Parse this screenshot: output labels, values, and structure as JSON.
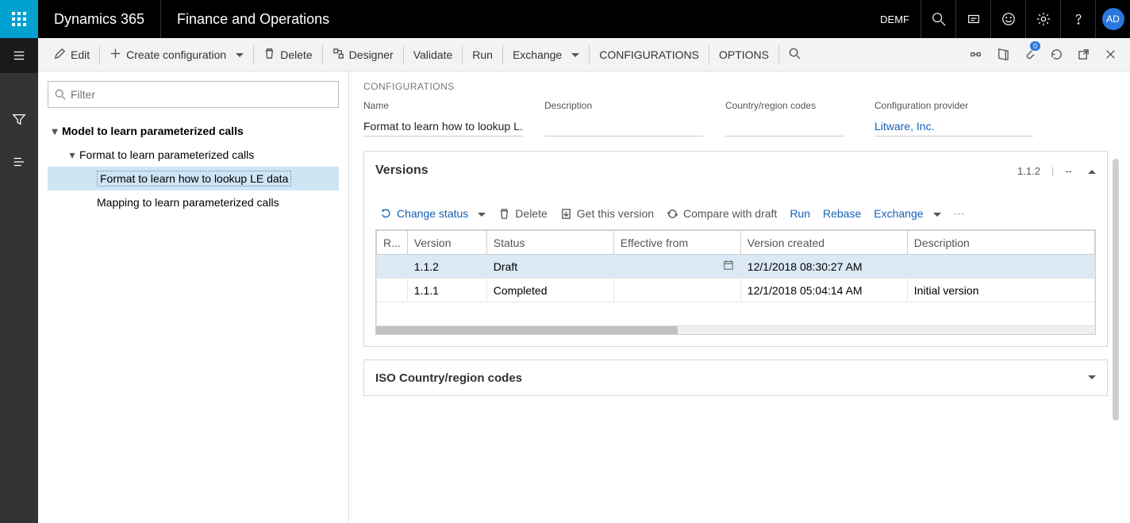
{
  "topbar": {
    "product": "Dynamics 365",
    "module": "Finance and Operations",
    "company": "DEMF",
    "avatar": "AD"
  },
  "actionbar": {
    "edit": "Edit",
    "create": "Create configuration",
    "delete": "Delete",
    "designer": "Designer",
    "validate": "Validate",
    "run": "Run",
    "exchange": "Exchange",
    "configurations": "CONFIGURATIONS",
    "options": "OPTIONS",
    "badge": "0"
  },
  "filter": {
    "placeholder": "Filter"
  },
  "tree": {
    "root": "Model to learn parameterized calls",
    "child1": "Format to learn parameterized calls",
    "grand1": "Format to learn how to lookup LE data",
    "grand2": "Mapping to learn parameterized calls"
  },
  "details": {
    "breadcrumb": "CONFIGURATIONS",
    "name_label": "Name",
    "name_value": "Format to learn how to lookup L...",
    "desc_label": "Description",
    "desc_value": "",
    "country_label": "Country/region codes",
    "country_value": "",
    "provider_label": "Configuration provider",
    "provider_value": "Litware, Inc."
  },
  "versions": {
    "title": "Versions",
    "summary": "1.1.2",
    "dash": "--",
    "toolbar": {
      "change_status": "Change status",
      "delete": "Delete",
      "get": "Get this version",
      "compare": "Compare with draft",
      "run": "Run",
      "rebase": "Rebase",
      "exchange": "Exchange"
    },
    "columns": {
      "r": "R...",
      "version": "Version",
      "status": "Status",
      "effective": "Effective from",
      "created": "Version created",
      "description": "Description"
    },
    "rows": [
      {
        "version": "1.1.2",
        "status": "Draft",
        "effective": "",
        "created": "12/1/2018 08:30:27 AM",
        "description": ""
      },
      {
        "version": "1.1.1",
        "status": "Completed",
        "effective": "",
        "created": "12/1/2018 05:04:14 AM",
        "description": "Initial version"
      }
    ]
  },
  "iso": {
    "title": "ISO Country/region codes"
  }
}
